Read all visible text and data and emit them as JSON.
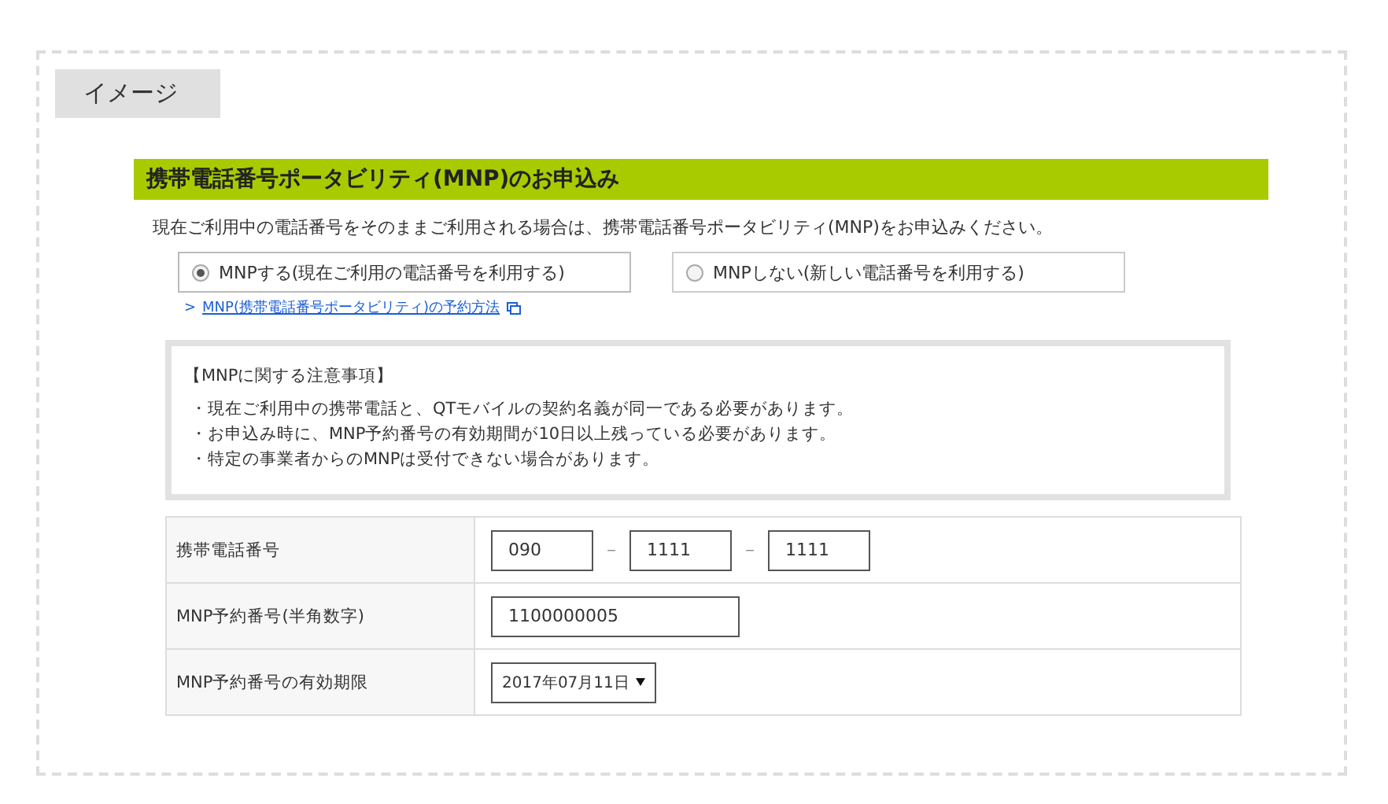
{
  "tag": "イメージ",
  "heading": "携帯電話番号ポータビリティ(MNP)のお申込み",
  "intro": "現在ご利用中の電話番号をそのままご利用される場合は、携帯電話番号ポータビリティ(MNP)をお申込みください。",
  "options": [
    {
      "label": "MNPする(現在ご利用の電話番号を利用する)",
      "selected": true
    },
    {
      "label": "MNPしない(新しい電話番号を利用する)",
      "selected": false
    }
  ],
  "link": {
    "arrow": ">",
    "text": "MNP(携帯電話番号ポータビリティ)の予約方法"
  },
  "notice": {
    "title": "【MNPに関する注意事項】",
    "items": [
      "・現在ご利用中の携帯電話と、QTモバイルの契約名義が同一である必要があります。",
      "・お申込み時に、MNP予約番号の有効期間が10日以上残っている必要があります。",
      "・特定の事業者からのMNPは受付できない場合があります。"
    ]
  },
  "rows": [
    {
      "label": "携帯電話番号",
      "parts": [
        {
          "kind": "input",
          "value": "090"
        },
        {
          "kind": "dash",
          "text": "－"
        },
        {
          "kind": "input",
          "value": "1111"
        },
        {
          "kind": "dash",
          "text": "－"
        },
        {
          "kind": "input",
          "value": "1111"
        }
      ]
    },
    {
      "label": "MNP予約番号(半角数字)",
      "parts": [
        {
          "kind": "wide",
          "value": "1100000005"
        }
      ]
    },
    {
      "label": "MNP予約番号の有効期限",
      "parts": [
        {
          "kind": "select",
          "value": "2017年07月11日"
        }
      ]
    }
  ]
}
